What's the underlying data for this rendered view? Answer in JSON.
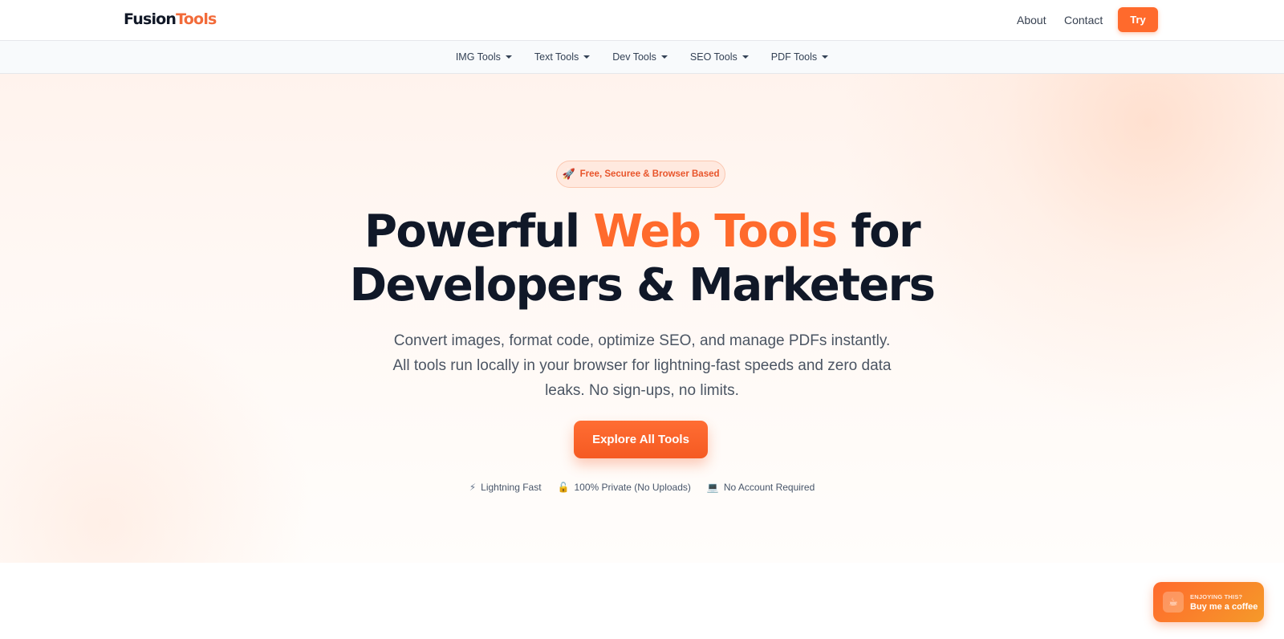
{
  "header": {
    "logo_primary": "Fusion",
    "logo_accent": "Tools",
    "links": {
      "about": "About",
      "contact": "Contact"
    },
    "try_label": "Try"
  },
  "categories": [
    {
      "label": "IMG Tools"
    },
    {
      "label": "Text Tools"
    },
    {
      "label": "Dev Tools"
    },
    {
      "label": "SEO Tools"
    },
    {
      "label": "PDF Tools"
    }
  ],
  "hero": {
    "badge_icon": "rocket-icon",
    "badge_text": "Free, Securee & Browser Based",
    "headline_part1": "Powerful ",
    "headline_accent": "Web Tools",
    "headline_part2": " for",
    "headline_line2": "Developers & Marketers",
    "subtext": "Convert images, format code, optimize SEO, and manage PDFs instantly. All tools run locally in your browser for lightning-fast speeds and zero data leaks. No sign-ups, no limits.",
    "cta_label": "Explore All Tools"
  },
  "features": [
    {
      "icon": "lightning-icon",
      "label": "Lightning Fast"
    },
    {
      "icon": "lock-icon",
      "label": "100% Private (No Uploads)"
    },
    {
      "icon": "laptop-icon",
      "label": "No Account Required"
    }
  ],
  "coffee_widget": {
    "icon": "coffee-cup-icon",
    "small_text": "ENJOYING THIS?",
    "big_text": "Buy me a coffee"
  },
  "colors": {
    "accent": "#ff6a2c",
    "headline": "#101828",
    "body_text": "#4b5563"
  }
}
